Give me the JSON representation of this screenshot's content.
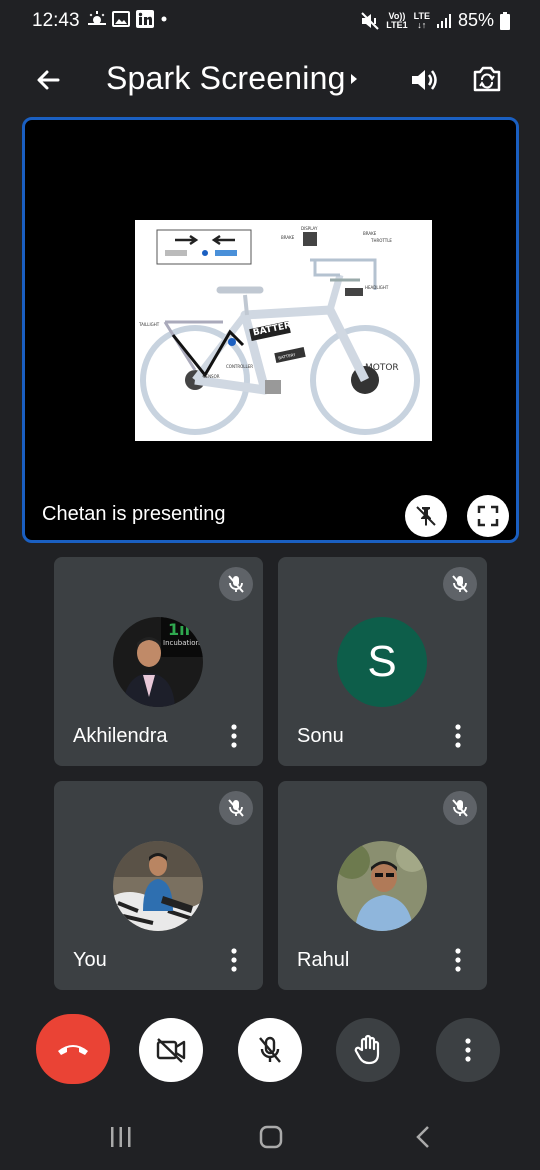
{
  "status_bar": {
    "time": "12:43",
    "volte_line1": "Vo))",
    "volte_line2": "LTE1",
    "lte_line1": "LTE",
    "battery_percent": "85%"
  },
  "header": {
    "title": "Spark Screening"
  },
  "presentation": {
    "presenter_label": "Chetan is presenting",
    "slide_labels": {
      "battery_frame": "BATTERY",
      "battery": "BATTERY",
      "motor": "MOTOR",
      "taillight": "TAILLIGHT",
      "headlight": "HEADLIGHT",
      "display": "DISPLAY",
      "brake_left": "BRAKE",
      "brake_right": "BRAKE",
      "throttle": "THROTTLE",
      "controller": "CONTROLLER",
      "sensor": "SENSOR"
    }
  },
  "participants": [
    {
      "name": "Akhilendra",
      "muted": true,
      "avatar": "photo",
      "banner_text": "Incubation M"
    },
    {
      "name": "Sonu",
      "muted": true,
      "avatar": "initial",
      "initial": "S",
      "avatar_color": "#0d5e4a"
    },
    {
      "name": "You",
      "muted": true,
      "avatar": "photo"
    },
    {
      "name": "Rahul",
      "muted": true,
      "avatar": "photo"
    }
  ],
  "controls": {
    "end_call_color": "#ea4335",
    "items": [
      "end-call",
      "camera-off",
      "mic-off",
      "raise-hand",
      "more-options"
    ]
  },
  "colors": {
    "background": "#202124",
    "tile": "#3c4043",
    "presentation_border": "#1a5fc1"
  }
}
